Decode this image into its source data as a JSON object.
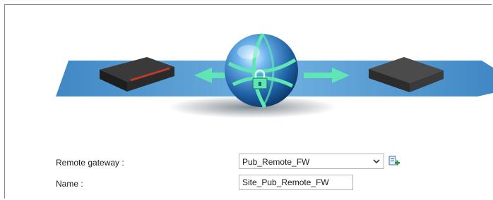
{
  "form": {
    "remote_gateway": {
      "label": "Remote gateway :",
      "selected": "Pub_Remote_FW"
    },
    "name": {
      "label": "Name :",
      "value": "Site_Pub_Remote_FW"
    }
  },
  "icons": {
    "dropdown": "chevron-down-icon",
    "add": "add-object-icon",
    "globe": "globe-icon",
    "lock": "lock-icon",
    "local_device": "firewall-appliance-icon",
    "remote_device": "firewall-appliance-icon"
  },
  "colors": {
    "plane": "#3d86c2",
    "globe": "#1f6fb5",
    "arrows": "#5fe6b4"
  }
}
